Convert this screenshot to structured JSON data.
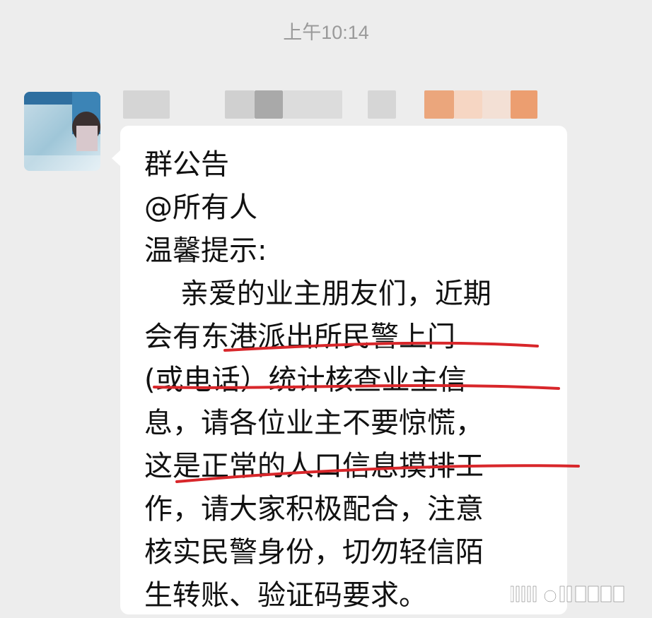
{
  "status": {
    "timestamp": "上午10:14"
  },
  "message": {
    "lines": [
      "群公告",
      "@所有人",
      "温馨提示:",
      "    亲爱的业主朋友们，近期",
      "会有东港派出所民警上门",
      "(或电话）统计核查业主信",
      "息，请各位业主不要惊慌，",
      "这是正常的人口信息摸排工",
      "作，请大家积极配合，注意",
      "核实民警身份，切勿轻信陌",
      "生转账、验证码要求。"
    ]
  },
  "colors": {
    "background": "#ededed",
    "bubble": "#ffffff",
    "annotation": "#d8262a"
  },
  "icons": {
    "sender_avatar": "avatar-image"
  }
}
